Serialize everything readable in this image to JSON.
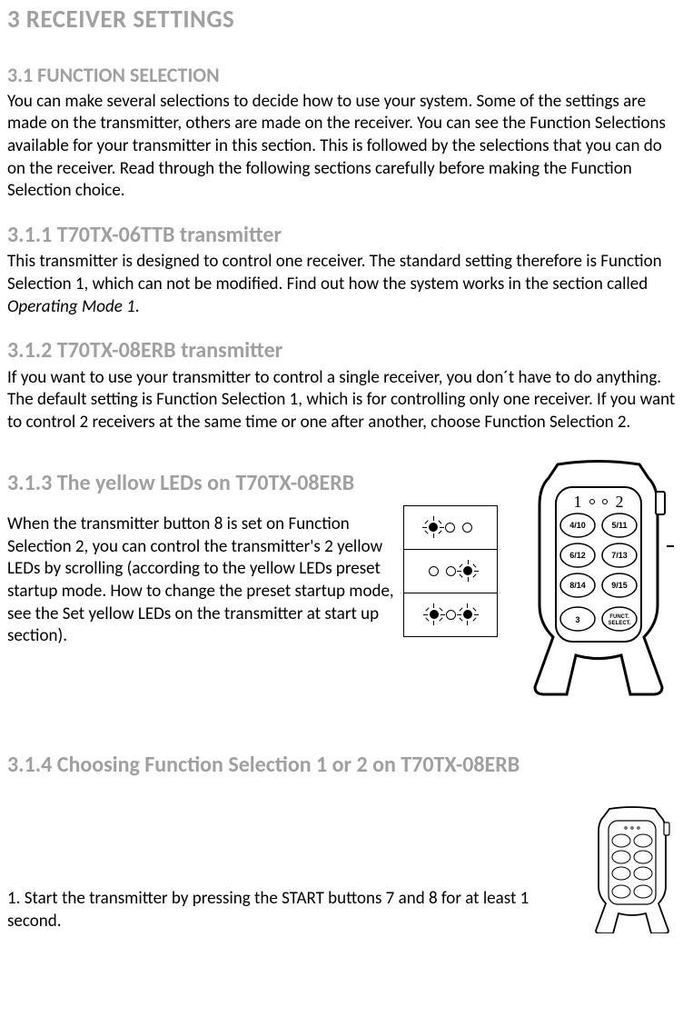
{
  "h1": "3 RECEIVER SETTINGS",
  "s31": {
    "title": "3.1 FUNCTION SELECTION",
    "body": "You can make several selections to decide how to use your system. Some of the settings are made on the transmitter, others are made on the receiver. You can see the Function Selections available for your transmitter in this section. This is followed by the selections that you can do on the receiver. Read through the following sections carefully before making the Function Selection choice."
  },
  "s311": {
    "title": "3.1.1 T70TX-06TTB transmitter",
    "body1": "This transmitter is designed to control one receiver. The standard setting therefore is Function Selection 1, which can not be modified. Find out how the system works in the section called ",
    "body2_italic": "Operating Mode 1",
    "body3": "."
  },
  "s312": {
    "title": "3.1.2 T70TX-08ERB transmitter",
    "body": "If you want to use your transmitter to control a single receiver, you don´t have to do anything. The default setting is Function Selection 1, which is for controlling only one receiver. If you want to control 2 receivers at the same time or one after another, choose Function Selection 2."
  },
  "s313": {
    "title": "3.1.3  The yellow LEDs on T70TX-08ERB",
    "body": "When the transmitter button 8 is set on Function Selection 2, you can control the transmitter's 2 yellow LEDs by scrolling (according to the yellow LEDs preset startup mode. How to change the preset startup mode, see the Set yellow LEDs on the transmitter at start up section)."
  },
  "s314": {
    "title": "3.1.4  Choosing Function Selection 1 or 2 on T70TX-08ERB",
    "step1": "1. Start the transmitter by pressing the START buttons 7 and 8 for at least 1 second."
  },
  "device": {
    "top1": "1",
    "top2": "2",
    "b1": "4/10",
    "b2": "5/11",
    "b3": "6/12",
    "b4": "7/13",
    "b5": "8/14",
    "b6": "9/15",
    "b7": "3",
    "b8a": "FUNCT.",
    "b8b": "SELECT."
  }
}
